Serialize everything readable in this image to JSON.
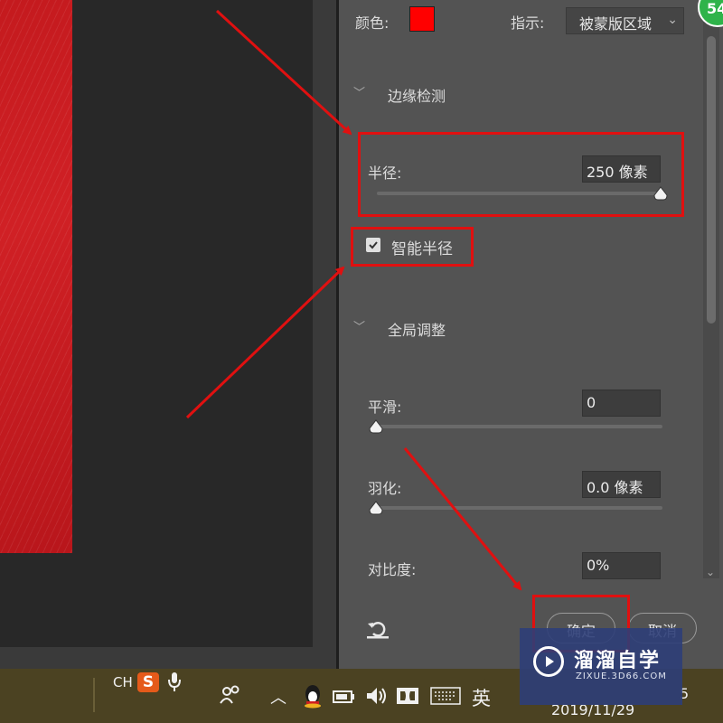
{
  "panel": {
    "color_label": "颜色:",
    "color_value": "#ff0000",
    "indicator_label": "指示:",
    "indicator_value": "被蒙版区域",
    "edge_section_title": "边缘检测",
    "radius_label": "半径:",
    "radius_value": "250 像素",
    "radius_level": 1.0,
    "smart_radius_label": "智能半径",
    "smart_radius_checked": true,
    "global_section_title": "全局调整",
    "smooth_label": "平滑:",
    "smooth_value": "0",
    "smooth_level": 0,
    "feather_label": "羽化:",
    "feather_value": "0.0 像素",
    "feather_level": 0,
    "contrast_label": "对比度:",
    "contrast_value": "0%",
    "ok_label": "确定",
    "cancel_label": "取消"
  },
  "badge_number": "54",
  "taskbar": {
    "lang_label": "CH",
    "ime_label": "英",
    "date": "2019/11/29",
    "time_partial": "5"
  },
  "watermark": {
    "title": "溜溜自学",
    "subtitle": "ZIXUE.3D66.COM"
  },
  "colors": {
    "panel_bg": "#535353",
    "highlight": "#e01010",
    "accent_red": "#ff0000",
    "taskbar_bg": "#4b4222"
  }
}
